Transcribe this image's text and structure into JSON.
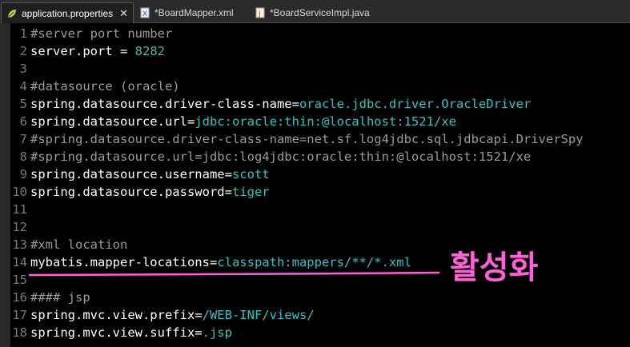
{
  "tabs": [
    {
      "label": "application.properties",
      "active": true,
      "icon": "properties-file-icon",
      "close": "✕"
    },
    {
      "label": "*BoardMapper.xml",
      "active": false,
      "icon": "xml-file-icon"
    },
    {
      "label": "*BoardServiceImpl.java",
      "active": false,
      "icon": "java-file-icon"
    }
  ],
  "lines": [
    {
      "n": "1",
      "key": "",
      "val": "",
      "comment": "#server port number"
    },
    {
      "n": "2",
      "key": "server.port = ",
      "val": "8282",
      "comment": ""
    },
    {
      "n": "3",
      "key": "",
      "val": "",
      "comment": ""
    },
    {
      "n": "4",
      "key": "",
      "val": "",
      "comment": "#datasource (oracle)"
    },
    {
      "n": "5",
      "key": "spring.datasource.driver-class-name=",
      "val": "oracle.jdbc.driver.OracleDriver",
      "comment": ""
    },
    {
      "n": "6",
      "key": "spring.datasource.url=",
      "val": "jdbc:oracle:thin:@localhost:1521/xe",
      "comment": ""
    },
    {
      "n": "7",
      "key": "",
      "val": "",
      "comment": "#spring.datasource.driver-class-name=net.sf.log4jdbc.sql.jdbcapi.DriverSpy"
    },
    {
      "n": "8",
      "key": "",
      "val": "",
      "comment": "#spring.datasource.url=jdbc:log4jdbc:oracle:thin:@localhost:1521/xe"
    },
    {
      "n": "9",
      "key": "spring.datasource.username=",
      "val": "scott",
      "comment": ""
    },
    {
      "n": "10",
      "key": "spring.datasource.password=",
      "val": "tiger",
      "comment": ""
    },
    {
      "n": "11",
      "key": "",
      "val": "",
      "comment": ""
    },
    {
      "n": "12",
      "key": "",
      "val": "",
      "comment": ""
    },
    {
      "n": "13",
      "key": "",
      "val": "",
      "comment": "#xml location"
    },
    {
      "n": "14",
      "key": "mybatis.mapper-locations=",
      "val": "classpath:mappers/**/*.xml",
      "comment": ""
    },
    {
      "n": "15",
      "key": "",
      "val": "",
      "comment": ""
    },
    {
      "n": "16",
      "key": "",
      "val": "",
      "comment": "#### jsp"
    },
    {
      "n": "17",
      "key": "spring.mvc.view.prefix=",
      "val": "/WEB-INF/views/",
      "comment": ""
    },
    {
      "n": "18",
      "key": "spring.mvc.view.suffix=",
      "val": ".jsp",
      "comment": ""
    }
  ],
  "annotation": {
    "text": "활성화",
    "color": "#ff5fd7"
  },
  "colors": {
    "key": "#ffffff",
    "value": "#31c3c3",
    "comment": "#9a9a9a",
    "line_number": "#7a7a7a"
  }
}
